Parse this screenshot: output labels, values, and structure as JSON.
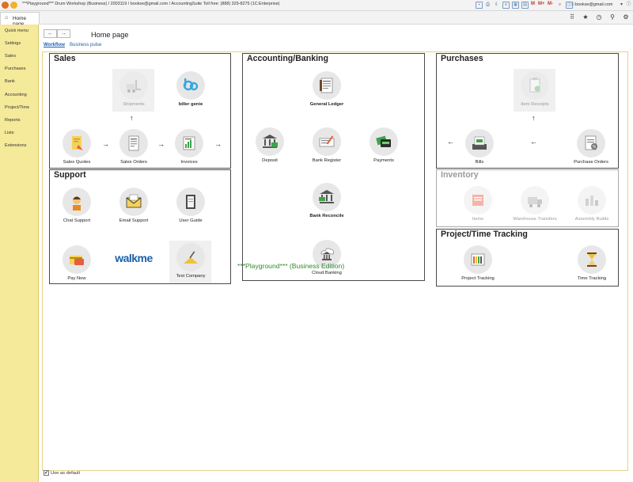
{
  "window": {
    "title": "***Playground*** Drum Workshop (Business) / 2003119 / bookse@gmail.com / AccountingSuite Toll free: (888) 329-8275  (1C:Enterprise)",
    "user": "bookse@gmail.com"
  },
  "toolbar": {
    "m_label": "M",
    "m_plus_label": "M+",
    "m_minus_label": "M-"
  },
  "tab": {
    "label": "Home page"
  },
  "sidebar": {
    "items": [
      {
        "label": "Quick menu"
      },
      {
        "label": "Settings"
      },
      {
        "label": "Sales"
      },
      {
        "label": "Purchases"
      },
      {
        "label": "Bank"
      },
      {
        "label": "Accounting"
      },
      {
        "label": "Project/Time"
      },
      {
        "label": "Reports"
      },
      {
        "label": "Lists"
      },
      {
        "label": "Extensions"
      }
    ]
  },
  "header": {
    "title": "Home page"
  },
  "subtabs": {
    "workflow": "Workflow",
    "business_pulse": "Business pulse"
  },
  "sales": {
    "title": "Sales",
    "shipments": "Shipments",
    "biller_genie": "biller genie",
    "quotes": "Sales Quotes",
    "orders": "Sales Orders",
    "invoices": "Invoices"
  },
  "support": {
    "title": "Support",
    "chat": "Chat Support",
    "email": "Email Support",
    "guide": "User Guide",
    "pay_now": "Pay Now",
    "walkme": "walkme",
    "test_company": "Test Company"
  },
  "banking": {
    "title": "Accounting/Banking",
    "general_ledger": "General Ledger",
    "deposit": "Deposit",
    "bank_register": "Bank Register",
    "payments": "Payments",
    "bank_reconcile": "Bank Reconcile",
    "cloud_banking": "Cloud Banking"
  },
  "purchases": {
    "title": "Purchases",
    "item_receipts": "Item Receipts",
    "bills": "Bills",
    "purchase_orders": "Purchase Orders"
  },
  "inventory": {
    "title": "Inventory",
    "items": "Items",
    "warehouse_transfers": "Warehouse Transfers",
    "assembly_builds": "Assembly Builds"
  },
  "project": {
    "title": "Project/Time Tracking",
    "project_tracking": "Project Tracking",
    "time_tracking": "Time Tracking"
  },
  "footer": {
    "playground_note": "***Playground*** (Business Edition)",
    "use_as_default": "Use as default"
  },
  "icons": {
    "arrow_right": "→",
    "arrow_left": "←",
    "arrow_up": "↑",
    "check": "✔"
  },
  "colors": {
    "sidebar_bg": "#f5e99a",
    "link": "#1a5fb4",
    "playground_green": "#2f8a2f"
  }
}
